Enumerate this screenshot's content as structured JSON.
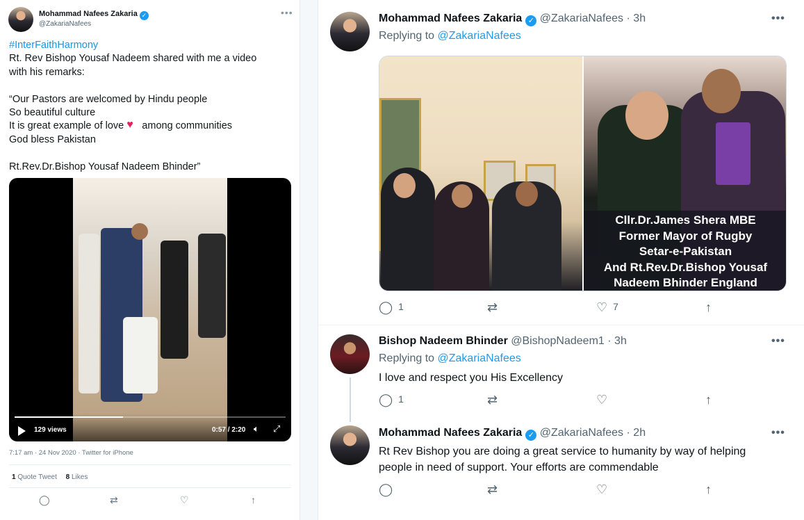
{
  "left_tweet": {
    "author_name": "Mohammad Nafees Zakaria",
    "author_handle": "@ZakariaNafees",
    "more": "•••",
    "hashtag": "#InterFaithHarmony",
    "text_line1": "Rt. Rev Bishop Yousaf Nadeem shared with me a video",
    "text_line2": "with his remarks:",
    "quote_line1": "“Our Pastors are welcomed by Hindu people",
    "quote_line2": "So beautiful culture",
    "quote_line3a": "It is great example of love",
    "quote_line3b": "among communities",
    "quote_line4": "God bless Pakistan",
    "signature": "Rt.Rev.Dr.Bishop Yousaf Nadeem Bhinder”",
    "video": {
      "views": "129 views",
      "time": "0:57 / 2:20",
      "progress_fraction": 0.4
    },
    "meta": "7:17 am · 24 Nov 2020 · Twitter for iPhone",
    "stats": {
      "quote_count": "1",
      "quote_label": "Quote Tweet",
      "likes_count": "8",
      "likes_label": "Likes"
    },
    "actions": [
      "reply-icon",
      "retweet-icon",
      "like-icon",
      "share-icon"
    ]
  },
  "thread": [
    {
      "author_name": "Mohammad Nafees Zakaria",
      "author_handle": "@ZakariaNafees",
      "time": "· 3h",
      "replying_prefix": "Replying to",
      "replying_to": "@ZakariaNafees",
      "more": "•••",
      "photo_caption": [
        "Cllr.Dr.James Shera MBE",
        "Former Mayor of Rugby",
        "Setar-e-Pakistan",
        "And Rt.Rev.Dr.Bishop Yousaf",
        "Nadeem Bhinder England"
      ],
      "reply_count": "1",
      "retweet_count": "",
      "like_count": "7"
    },
    {
      "author_name": "Bishop Nadeem Bhinder",
      "author_handle": "@BishopNadeem1",
      "time": "· 3h",
      "replying_prefix": "Replying to",
      "replying_to": "@ZakariaNafees",
      "more": "•••",
      "text": "I love and respect you His Excellency",
      "reply_count": "1",
      "retweet_count": "",
      "like_count": ""
    },
    {
      "author_name": "Mohammad Nafees Zakaria",
      "author_handle": "@ZakariaNafees",
      "time": "· 2h",
      "more": "•••",
      "text_line1": "Rt Rev Bishop you are doing a great service to humanity by way of helping",
      "text_line2": "people in need of support. Your efforts are commendable",
      "reply_count": "",
      "retweet_count": "",
      "like_count": ""
    }
  ],
  "icons": {
    "reply": "◯",
    "retweet": "⇄",
    "like": "♡",
    "share": "↑",
    "verified_check": "✓"
  },
  "colors": {
    "link": "#1d9bf0",
    "verified": "#1d9bf0",
    "text": "#0f1419",
    "muted": "#536471"
  }
}
